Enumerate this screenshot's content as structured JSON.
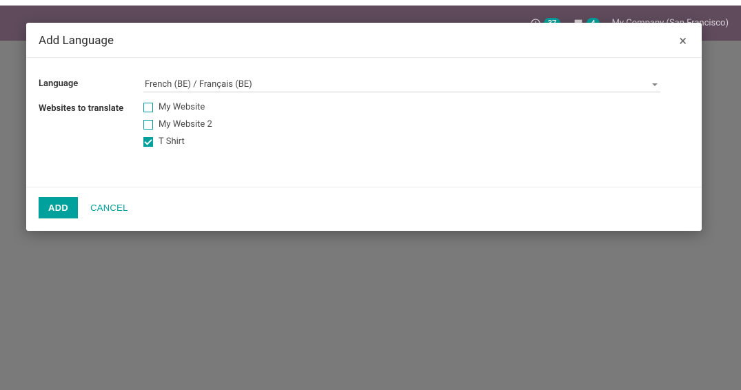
{
  "navbar": {
    "badge1": "37",
    "badge2": "4",
    "company": "My Company (San Francisco)"
  },
  "modal": {
    "title": "Add Language",
    "form": {
      "language_label": "Language",
      "language_value": "French (BE) / Français (BE)",
      "websites_label": "Websites to translate",
      "websites": [
        {
          "label": "My Website",
          "checked": false
        },
        {
          "label": "My Website 2",
          "checked": false
        },
        {
          "label": "T Shirt",
          "checked": true
        }
      ]
    },
    "footer": {
      "add": "Add",
      "cancel": "Cancel"
    }
  }
}
